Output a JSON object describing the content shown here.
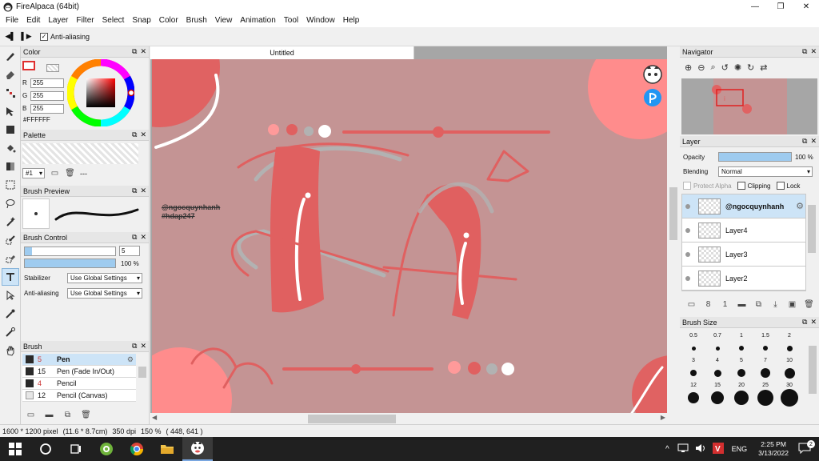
{
  "window": {
    "title": "FireAlpaca (64bit)",
    "minimize": "—",
    "maximize": "❐",
    "close": "✕"
  },
  "menu": [
    "File",
    "Edit",
    "Layer",
    "Filter",
    "Select",
    "Snap",
    "Color",
    "Brush",
    "View",
    "Animation",
    "Tool",
    "Window",
    "Help"
  ],
  "tool_options": {
    "anti_aliasing_label": "Anti-aliasing",
    "anti_aliasing_checked": true,
    "check_glyph": "✓",
    "prev": "◀▌",
    "next": "▌▶"
  },
  "panel_buttons": {
    "float": "⧉",
    "close": "✕"
  },
  "color_panel": {
    "title": "Color",
    "r_label": "R",
    "r": "255",
    "g_label": "G",
    "g": "255",
    "b_label": "B",
    "b": "255",
    "hex": "#FFFFFF"
  },
  "palette_panel": {
    "title": "Palette",
    "index": "#1",
    "dash": "---"
  },
  "brush_preview_panel": {
    "title": "Brush Preview"
  },
  "brush_control_panel": {
    "title": "Brush Control",
    "size_value": "5",
    "size_fraction": 0.08,
    "opacity_value": "100 %",
    "opacity_fraction": 1.0,
    "stabilizer_label": "Stabilizer",
    "stabilizer_value": "Use Global Settings",
    "anti_aliasing_label": "Anti-aliasing",
    "anti_aliasing_value": "Use Global Settings"
  },
  "brush_panel": {
    "title": "Brush",
    "items": [
      {
        "size": "5",
        "name": "Pen",
        "selected": true
      },
      {
        "size": "15",
        "name": "Pen (Fade In/Out)",
        "selected": false
      },
      {
        "size": "4",
        "name": "Pencil",
        "selected": false
      },
      {
        "size": "12",
        "name": "Pencil (Canvas)",
        "selected": false
      }
    ]
  },
  "document": {
    "tab_title": "Untitled"
  },
  "artwork": {
    "watermark_line1": "@ngocquynhanh",
    "watermark_line2": "#hdap247"
  },
  "navigator_panel": {
    "title": "Navigator"
  },
  "layer_panel": {
    "title": "Layer",
    "opacity_label": "Opacity",
    "opacity_value": "100 %",
    "opacity_fraction": 1.0,
    "blending_label": "Blending",
    "blending_value": "Normal",
    "protect_alpha_label": "Protect Alpha",
    "clipping_label": "Clipping",
    "lock_label": "Lock",
    "layers": [
      {
        "name": "@ngocquynhanh",
        "active": true
      },
      {
        "name": "Layer4",
        "active": false
      },
      {
        "name": "Layer3",
        "active": false
      },
      {
        "name": "Layer2",
        "active": false
      }
    ]
  },
  "brush_size_panel": {
    "title": "Brush Size",
    "sizes": [
      "0.5",
      "0.7",
      "1",
      "1.5",
      "2",
      "3",
      "4",
      "5",
      "7",
      "10",
      "12",
      "15",
      "20",
      "25",
      "30"
    ]
  },
  "status_bar": {
    "dimensions": "1600 * 1200 pixel",
    "physical": "(11.6 * 8.7cm)",
    "dpi": "350 dpi",
    "zoom": "150 %",
    "cursor": "( 448, 641 )"
  },
  "taskbar": {
    "lang": "ENG",
    "time": "2:25 PM",
    "date": "3/13/2022",
    "notif_count": "2",
    "tray_chevron": "^"
  },
  "colors": {
    "accent": "#cde4f7",
    "canvas_bg": "#c49494",
    "shape_red": "#e06060",
    "light_coral": "#ff8c8c"
  }
}
